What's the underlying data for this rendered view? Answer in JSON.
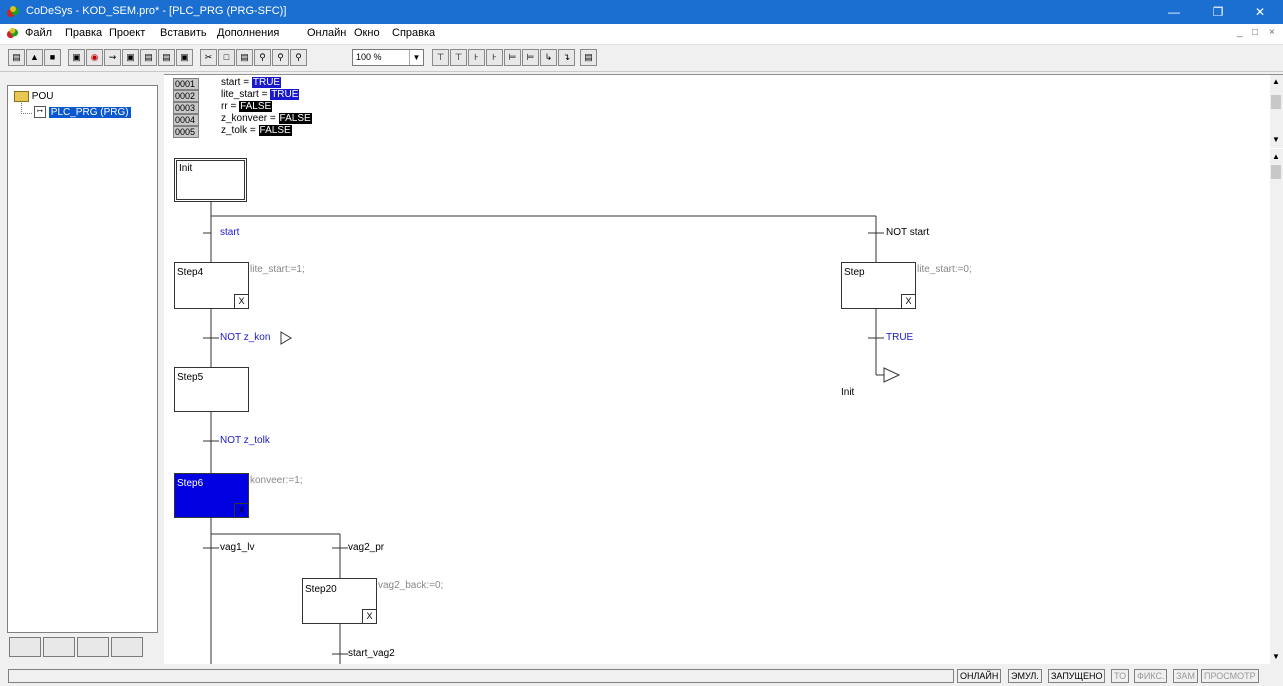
{
  "window": {
    "title": "CoDeSys - KOD_SEM.pro* - [PLC_PRG (PRG-SFC)]"
  },
  "menu": [
    "Файл",
    "Правка",
    "Проект",
    "Вставить",
    "Дополнения",
    "Онлайн",
    "Окно",
    "Справка"
  ],
  "toolbar": {
    "zoom": "100 %"
  },
  "tree": {
    "root": "POU",
    "child": "PLC_PRG (PRG)"
  },
  "vars": {
    "lines": [
      {
        "no": "0001",
        "name": "start = ",
        "value": "TRUE",
        "color": "#1a1acc"
      },
      {
        "no": "0002",
        "name": "lite_start = ",
        "value": "TRUE",
        "color": "#1a1acc"
      },
      {
        "no": "0003",
        "name": "rr = ",
        "value": "FALSE",
        "color": "#000000"
      },
      {
        "no": "0004",
        "name": "z_konveer = ",
        "value": "FALSE",
        "color": "#000000"
      },
      {
        "no": "0005",
        "name": "z_tolk = ",
        "value": "FALSE",
        "color": "#000000"
      }
    ]
  },
  "sfc": {
    "steps": {
      "init": "Init",
      "step4": "Step4",
      "step": "Step",
      "step5": "Step5",
      "step6": "Step6",
      "step20": "Step20"
    },
    "actions": {
      "step4": "lite_start:=1;",
      "step": "lite_start:=0;",
      "step6": "konveer:=1;",
      "step20": "vag2_back:=0;"
    },
    "transitions": {
      "start": "start",
      "not_start": "NOT start",
      "not_z_kon": "NOT z_kon",
      "true": "TRUE",
      "not_z_tolk": "NOT z_tolk",
      "vag1_lv": "vag1_lv",
      "vag2_pr": "vag2_pr",
      "start_vag2": "start_vag2"
    },
    "jump_label": "Init",
    "x_mark": "X",
    "active_color": "#0000e0"
  },
  "status": [
    "ОНЛАЙН",
    "ЭМУЛ.",
    "ЗАПУЩЕНО",
    "ТО",
    "ФИКС.",
    "ЗАМ",
    "ПРОСМОТР"
  ]
}
